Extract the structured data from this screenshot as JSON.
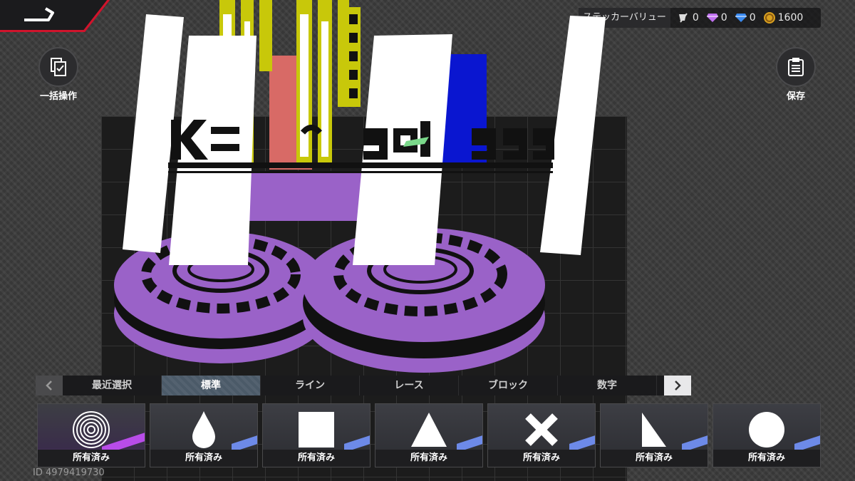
{
  "currency": {
    "sticker_value_label": "ステッカーバリュー",
    "values": [
      "0",
      "0",
      "0",
      "1600"
    ]
  },
  "side_buttons": {
    "bulk_label": "一括操作",
    "save_label": "保存"
  },
  "tabs": [
    "最近選択",
    "標準",
    "ライン",
    "レース",
    "ブロック",
    "数字"
  ],
  "active_tab": 1,
  "items": [
    {
      "shape": "concentric-circles",
      "owned": "所有済み"
    },
    {
      "shape": "drop",
      "owned": "所有済み"
    },
    {
      "shape": "square",
      "owned": "所有済み"
    },
    {
      "shape": "triangle",
      "owned": "所有済み"
    },
    {
      "shape": "cross",
      "owned": "所有済み"
    },
    {
      "shape": "right-triangle",
      "owned": "所有済み"
    },
    {
      "shape": "circle",
      "owned": "所有済み"
    }
  ],
  "player_id": "ID 4979419730",
  "colors": {
    "accent_red": "#d0142c",
    "purple": "#9a62c8",
    "yellow": "#c8c80a",
    "salmon": "#d86a66",
    "blue": "#0a16d0",
    "tab_active": "#4b5a68"
  }
}
